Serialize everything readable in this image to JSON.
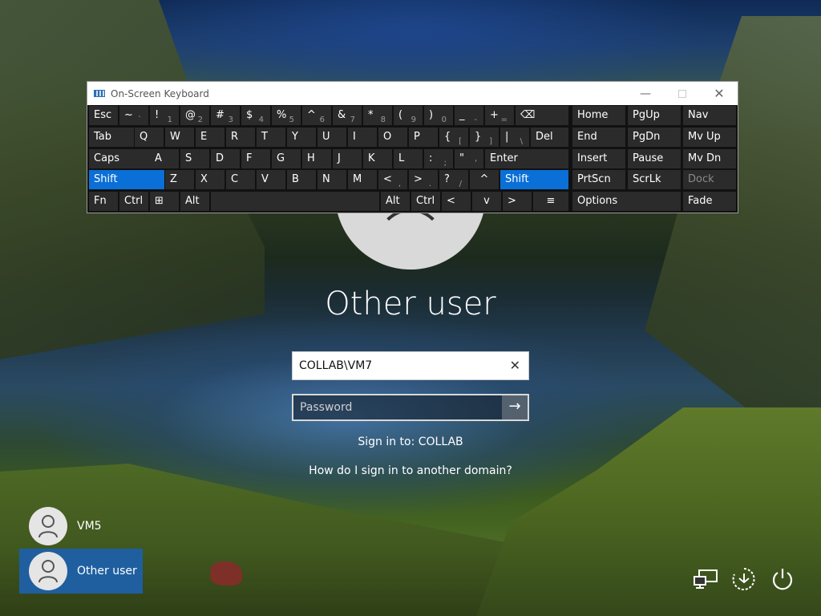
{
  "osk": {
    "title": "On-Screen Keyboard",
    "rows": {
      "r1": [
        "Esc",
        "~",
        "!",
        "@",
        "#",
        "$",
        "%",
        "^",
        "&",
        "*",
        "(",
        ")",
        "_",
        "+",
        "⌫",
        "Home",
        "PgUp",
        "Nav"
      ],
      "r1sub": [
        "",
        "`",
        "1",
        "2",
        "3",
        "4",
        "5",
        "6",
        "7",
        "8",
        "9",
        "0",
        "-",
        "="
      ],
      "r2": [
        "Tab",
        "Q",
        "W",
        "E",
        "R",
        "T",
        "Y",
        "U",
        "I",
        "O",
        "P",
        "{",
        "}",
        "|",
        "Del",
        "End",
        "PgDn",
        "Mv Up"
      ],
      "r2sub": [
        "[",
        "]",
        "\\"
      ],
      "r3": [
        "Caps",
        "A",
        "S",
        "D",
        "F",
        "G",
        "H",
        "J",
        "K",
        "L",
        ":",
        "\"",
        "Enter",
        "Insert",
        "Pause",
        "Mv Dn"
      ],
      "r3sub": [
        ";",
        "'"
      ],
      "r4": [
        "Shift",
        "Z",
        "X",
        "C",
        "V",
        "B",
        "N",
        "M",
        "<",
        ">",
        "?",
        "^",
        "Shift",
        "PrtScn",
        "ScrLk",
        "Dock"
      ],
      "r4sub": [
        ",",
        ".",
        "/"
      ],
      "r5": [
        "Fn",
        "Ctrl",
        "⊞",
        "Alt",
        "Alt",
        "Ctrl",
        "<",
        "v",
        ">",
        "≡",
        "Options",
        "Fade"
      ]
    }
  },
  "login": {
    "title": "Other user",
    "username_value": "COLLAB\\VM7",
    "password_placeholder": "Password",
    "sign_in_to": "Sign in to: COLLAB",
    "domain_link": "How do I sign in to another domain?"
  },
  "users": [
    {
      "name": "VM5",
      "selected": false
    },
    {
      "name": "Other user",
      "selected": true
    }
  ],
  "icons": {
    "network": "network-icon",
    "accessibility": "ease-of-access-icon",
    "power": "power-icon"
  }
}
